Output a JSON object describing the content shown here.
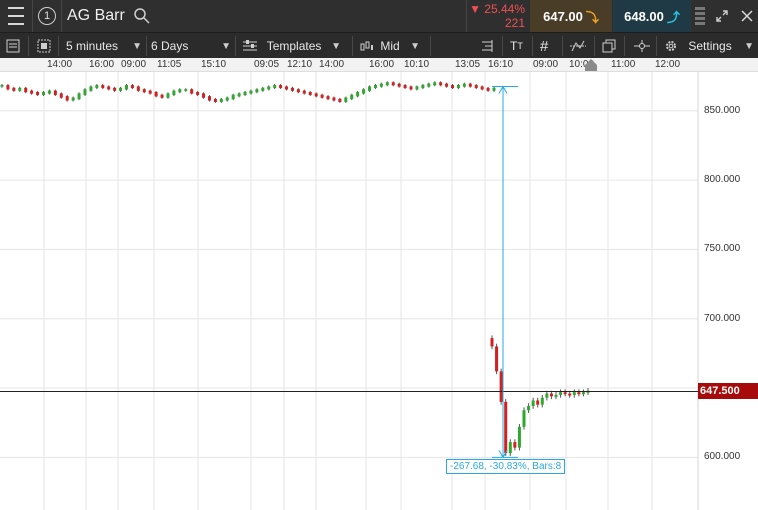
{
  "header": {
    "title": "AG Barr",
    "change_pct": "▼ 25.44%",
    "change_abs": "221",
    "sell_price": "647.00",
    "buy_price": "648.00",
    "info_number": "1"
  },
  "toolbar": {
    "interval": "5 minutes",
    "range": "6 Days",
    "templates_label": "Templates",
    "price_type": "Mid",
    "settings_label": "Settings"
  },
  "time_axis": [
    "14:00",
    "16:00",
    "09:00",
    "11:05",
    "15:10",
    "09:05",
    "12:10",
    "14:00",
    "16:00",
    "10:10",
    "13:05",
    "16:10",
    "09:00",
    "10:00",
    "11:00",
    "12:00"
  ],
  "chart_data": {
    "type": "line",
    "y_ticks": [
      "850.000",
      "800.000",
      "750.000",
      "700.000",
      "600.000"
    ],
    "current_price": "647.500",
    "ylim": [
      562,
      878
    ],
    "series_before": [
      868,
      866,
      865,
      866,
      864,
      863,
      862,
      863,
      864,
      862,
      860,
      858,
      859,
      862,
      865,
      867,
      868,
      867,
      866,
      865,
      866,
      868,
      867,
      865,
      864,
      863,
      861,
      860,
      862,
      864,
      865,
      865,
      863,
      862,
      860,
      858,
      857,
      858,
      859,
      861,
      862,
      863,
      864,
      865,
      866,
      867,
      868,
      867,
      866,
      865,
      864,
      863,
      862,
      861,
      860,
      859,
      858,
      857,
      859,
      861,
      863,
      865,
      867,
      868,
      869,
      870,
      869,
      868,
      867,
      866,
      867,
      868,
      869,
      870,
      869,
      868,
      867,
      868,
      869,
      868,
      867,
      866,
      865,
      866
    ],
    "series_after": [
      680,
      662,
      640,
      603,
      611,
      607,
      622,
      634,
      637,
      641,
      638,
      643,
      646,
      644,
      645,
      647,
      646,
      645,
      647,
      646,
      647,
      648
    ],
    "measurement": {
      "label": "-267.68, -30.83%, Bars:8",
      "from_price": 867.5,
      "to_price": 600.0
    }
  }
}
